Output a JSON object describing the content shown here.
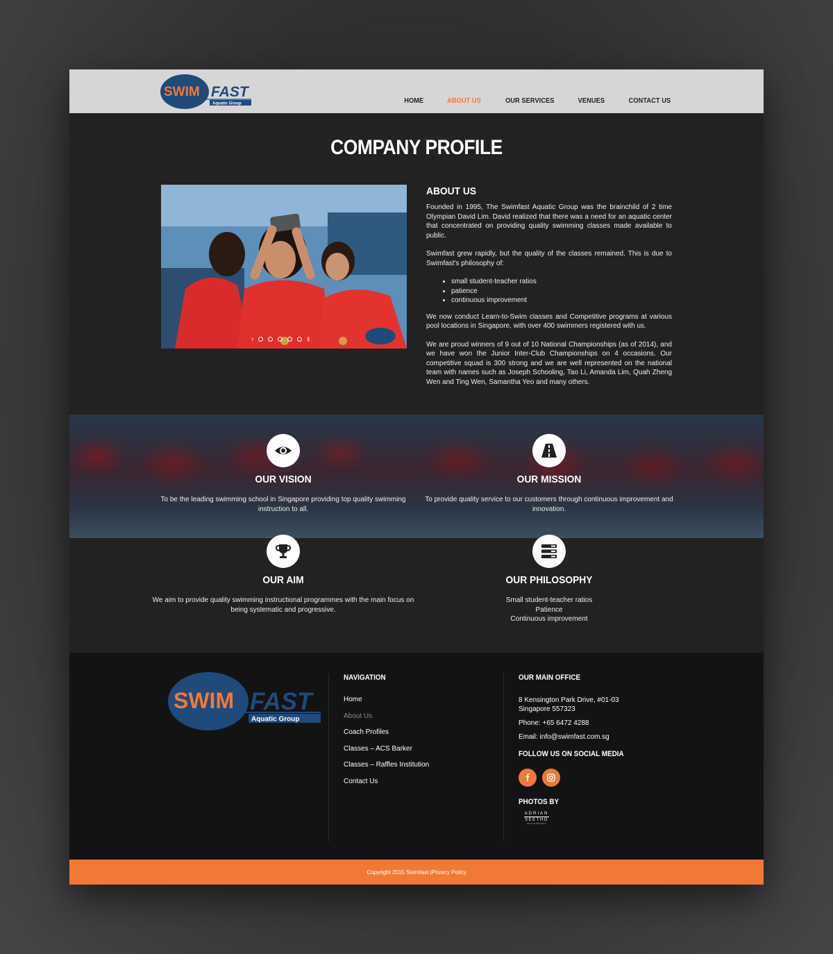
{
  "brand": {
    "logo_primary": "SWIM",
    "logo_secondary": "FAST",
    "logo_tagline": "Aquatic Group",
    "orange": "#f07935",
    "navy": "#1f4a7a"
  },
  "nav": {
    "items": [
      {
        "label": "HOME",
        "active": false
      },
      {
        "label": "ABOUT US",
        "active": true
      },
      {
        "label": "OUR SERVICES",
        "active": false
      },
      {
        "label": "VENUES",
        "active": false
      },
      {
        "label": "CONTACT US",
        "active": false
      }
    ]
  },
  "profile": {
    "title": "COMPANY PROFILE",
    "slider_total_slides": 5,
    "about_heading": "ABOUT US",
    "para1": "Founded in 1995, The Swimfast Aquatic Group was the brainchild of 2 time Olympian David Lim. David realized that there was a need for an aquatic center that concentrated on providing quality swimming classes made available to public.",
    "para2": "Swimfast grew rapidly, but the quality of the classes remained. This is due to Swimfast's philosophy of:",
    "bullets": [
      "small student-teacher ratios",
      "patience",
      "continuous improvement"
    ],
    "para3": "We now conduct Learn-to-Swim classes and Competitive programs at various pool locations in Singapore, with over 400 swimmers registered with us.",
    "para4": "We are proud winners of 9 out of 10 National Championships (as of 2014), and we have won the Junior Inter-Club Championships on 4 occasions. Our competitive squad is 300 strong and we are well represented on the national team with names such as Joseph Schooling, Tao Li, Amanda Lim, Quah Zheng Wen and Ting Wen, Samantha Yeo and many others."
  },
  "values": {
    "vision": {
      "icon": "eye-icon",
      "title": "OUR VISION",
      "text": "To be the leading swimming school in Singapore providing top quality swimming instruction to all."
    },
    "mission": {
      "icon": "road-icon",
      "title": "OUR MISSION",
      "text": "To provide quality service to our customers through continuous improvement and innovation."
    },
    "aim": {
      "icon": "trophy-icon",
      "title": "OUR AIM",
      "text": "We aim to provide quality swimming instructional programmes with the main focus on being systematic and progressive."
    },
    "philosophy": {
      "icon": "list-icon",
      "title": "OUR PHILOSOPHY",
      "lines": [
        "Small student-teacher ratios",
        "Patience",
        "Continuous improvement"
      ]
    }
  },
  "footer": {
    "nav_heading": "NAVIGATION",
    "links": [
      {
        "label": "Home",
        "dim": false
      },
      {
        "label": "About Us",
        "dim": true
      },
      {
        "label": "Coach Profiles",
        "dim": false
      },
      {
        "label": "Classes – ACS Barker",
        "dim": false
      },
      {
        "label": "Classes – Raffles Institution",
        "dim": false
      },
      {
        "label": "Contact Us",
        "dim": false
      }
    ],
    "office_heading": "OUR MAIN OFFICE",
    "address_line1": "8 Kensington Park Drive, #01-03",
    "address_line2": "Singapore 557323",
    "phone": "Phone: +65 6472 4288",
    "email": "Email: info@swimfast.com.sg",
    "social_heading": "FOLLOW US ON SOCIAL MEDIA",
    "social": [
      "facebook-icon",
      "instagram-icon"
    ],
    "photos_heading": "PHOTOS BY",
    "photographer_line1": "ADRIAN",
    "photographer_line2": "SEETHO",
    "photographer_line3": "PHOTOGRAPHY"
  },
  "copyright": {
    "text": "Copyright 2015 Swimfast | ",
    "link": "Privacy Policy"
  }
}
